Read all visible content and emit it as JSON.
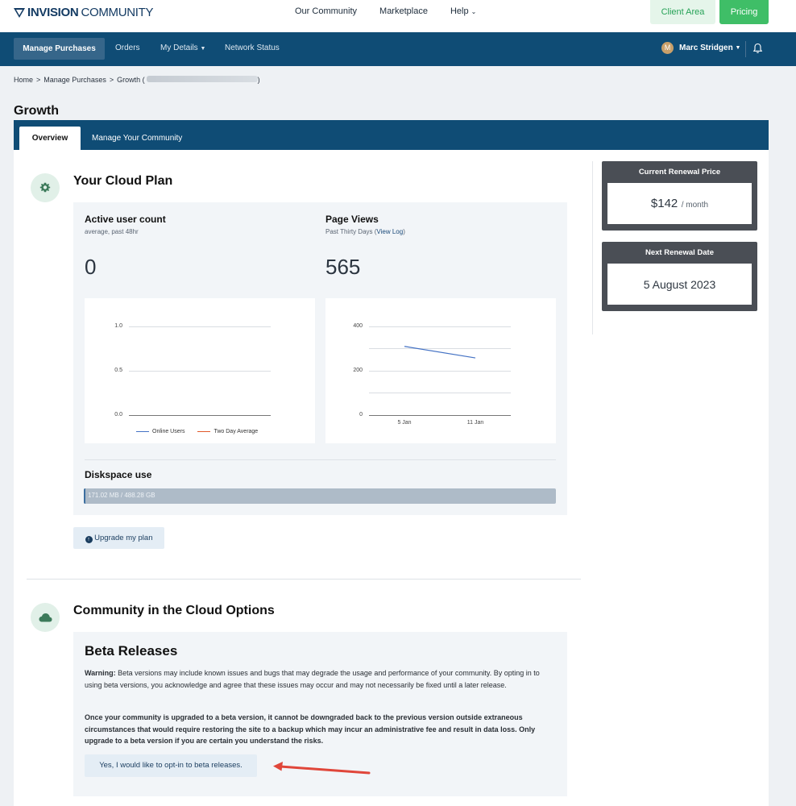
{
  "header": {
    "logo_bold": "INVISION",
    "logo_thin": "COMMUNITY",
    "nav": [
      "Our Community",
      "Marketplace",
      "Help"
    ],
    "client_area": "Client Area",
    "pricing": "Pricing"
  },
  "subnav": {
    "active": "Manage Purchases",
    "orders": "Orders",
    "my_details": "My Details",
    "network_status": "Network Status",
    "user_initial": "M",
    "user_name": "Marc Stridgen"
  },
  "breadcrumb": [
    "Home",
    "Manage Purchases",
    "Growth ("
  ],
  "breadcrumb_sep": ">",
  "breadcrumb_close": ")",
  "page_title": "Growth",
  "tabs": [
    "Overview",
    "Manage Your Community"
  ],
  "plan": {
    "title": "Your Cloud Plan",
    "active_users_label": "Active user count",
    "active_users_sub": "average, past 48hr",
    "active_users_value": "0",
    "page_views_label": "Page Views",
    "page_views_sub": "Past Thirty Days (",
    "page_views_link": "View Log",
    "page_views_sub_end": ")",
    "page_views_value": "565",
    "disk_label": "Diskspace use",
    "disk_text": "171.02 MB / 488.28 GB",
    "disk_fraction": 0.0004,
    "upgrade": "Upgrade my plan"
  },
  "chart_data": [
    {
      "type": "line",
      "y_ticks": [
        "1.0",
        "0.5",
        "0.0"
      ],
      "ylim": [
        0,
        1
      ],
      "series": [
        {
          "name": "Online Users",
          "color": "#4472c4",
          "values": []
        },
        {
          "name": "Two Day Average",
          "color": "#e0592a",
          "values": []
        }
      ]
    },
    {
      "type": "line",
      "y_ticks": [
        "400",
        "200",
        "0"
      ],
      "x_ticks": [
        "5 Jan",
        "11 Jan"
      ],
      "ylim": [
        0,
        400
      ],
      "series": [
        {
          "color": "#4472c4",
          "x": [
            "5 Jan",
            "11 Jan"
          ],
          "values": [
            310,
            258
          ]
        }
      ]
    }
  ],
  "renewal": {
    "price_title": "Current Renewal Price",
    "price": "$142",
    "per": "/ month",
    "date_title": "Next Renewal Date",
    "date": "5 August 2023"
  },
  "options": {
    "title": "Community in the Cloud Options",
    "beta_title": "Beta Releases",
    "warning_label": "Warning:",
    "warning_text": " Beta versions may include known issues and bugs that may degrade the usage and performance of your community. By opting in to using beta versions, you acknowledge and agree that these issues may occur and may not necessarily be fixed until a later release.",
    "notice": "Once your community is upgraded to a beta version, it cannot be downgraded back to the previous version outside extraneous circumstances that would require restoring the site to a backup which may incur an administrative fee and result in data loss. Only upgrade to a beta version if you are certain you understand the risks.",
    "optin": "Yes, I would like to opt-in to beta releases."
  },
  "colors": {
    "brand": "#0f4c75",
    "green": "#3fbe67",
    "arrow": "#e0463a"
  }
}
